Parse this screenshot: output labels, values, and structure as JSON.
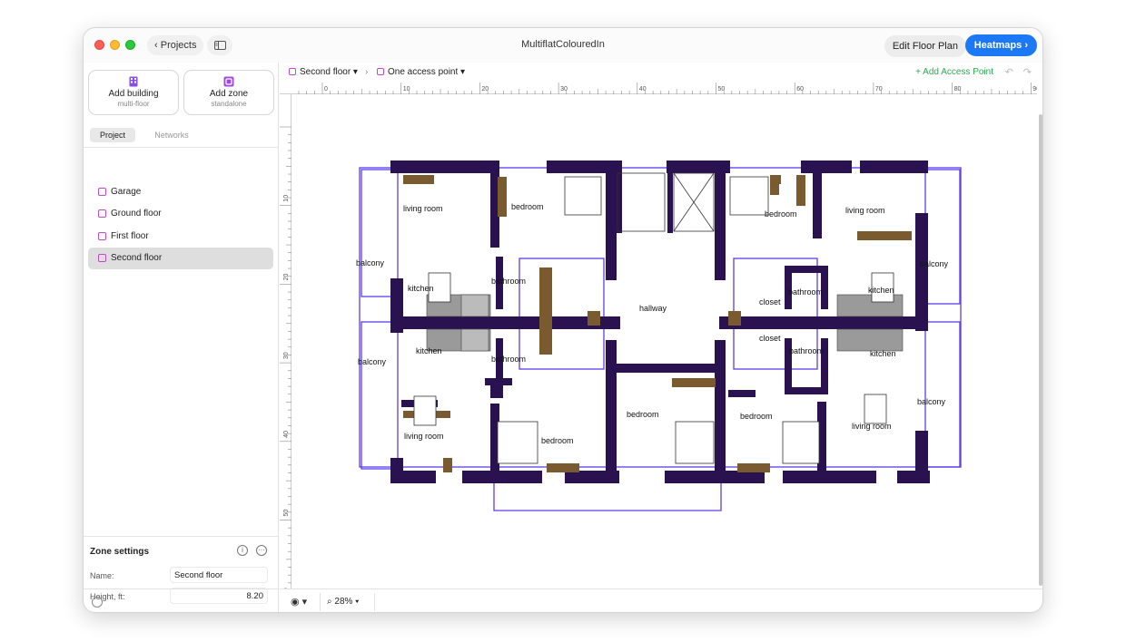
{
  "window": {
    "title": "MultiflatColouredIn"
  },
  "titlebar": {
    "back_label": "Projects",
    "edit_label": "Edit Floor Plan",
    "heatmaps_label": "Heatmaps"
  },
  "sidebar": {
    "add_building": {
      "label": "Add building",
      "sub": "multi-floor"
    },
    "add_zone": {
      "label": "Add zone",
      "sub": "standalone"
    },
    "tabs": [
      {
        "label": "Project",
        "active": true
      },
      {
        "label": "Networks",
        "active": false
      }
    ],
    "zones": [
      {
        "label": "Garage",
        "selected": false
      },
      {
        "label": "Ground floor",
        "selected": false
      },
      {
        "label": "First floor",
        "selected": false
      },
      {
        "label": "Second floor",
        "selected": true
      }
    ],
    "zone_settings": {
      "title": "Zone settings",
      "name_label": "Name:",
      "name_value": "Second floor",
      "height_label": "Height, ft:",
      "height_value": "8.20"
    }
  },
  "toolbar": {
    "breadcrumb_zone": "Second floor",
    "breadcrumb_ap": "One access point",
    "add_ap_label": "Add Access Point"
  },
  "ruler": {
    "top_ticks": [
      "0",
      "10",
      "20",
      "30",
      "40",
      "50",
      "60",
      "70",
      "80",
      "90"
    ],
    "left_ticks": [
      "10",
      "20",
      "30",
      "40",
      "50",
      "60"
    ]
  },
  "floorplan": {
    "rooms": [
      "living room",
      "bedroom",
      "balcony",
      "kitchen",
      "bathroom",
      "hallway",
      "bedroom",
      "living room",
      "balcony",
      "closet",
      "bathroom",
      "kitchen",
      "kitchen",
      "balcony",
      "bathroom",
      "closet",
      "bathroom",
      "kitchen",
      "living room",
      "bedroom",
      "bedroom",
      "bedroom",
      "living room",
      "balcony"
    ]
  },
  "bottom": {
    "zoom": "28%"
  },
  "colors": {
    "accent": "#1d78f5",
    "wall": "#2a1250",
    "zone": "#c04bc8",
    "add_ap": "#2eaa52"
  }
}
